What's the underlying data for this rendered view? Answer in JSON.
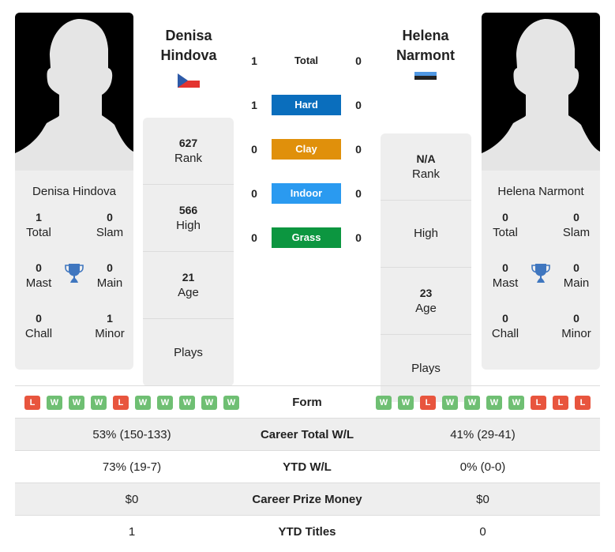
{
  "colors": {
    "hard": "#0a6ebd",
    "clay": "#e0900b",
    "indoor": "#2a9af0",
    "grass": "#0c9640",
    "win": "#6fbf73",
    "loss": "#e8553e",
    "trophy": "#3f76bf"
  },
  "player1": {
    "name_line1": "Denisa",
    "name_line2": "Hindova",
    "full_name": "Denisa Hindova",
    "flag": "czech-republic",
    "rank": "627",
    "rank_label": "Rank",
    "high": "566",
    "high_label": "High",
    "age": "21",
    "age_label": "Age",
    "plays": "",
    "plays_label": "Plays",
    "titles": {
      "total": "1",
      "total_label": "Total",
      "slam": "0",
      "slam_label": "Slam",
      "mast": "0",
      "mast_label": "Mast",
      "main": "0",
      "main_label": "Main",
      "chall": "0",
      "chall_label": "Chall",
      "minor": "1",
      "minor_label": "Minor"
    },
    "form": [
      "L",
      "W",
      "W",
      "W",
      "L",
      "W",
      "W",
      "W",
      "W",
      "W"
    ]
  },
  "player2": {
    "name_line1": "Helena",
    "name_line2": "Narmont",
    "full_name": "Helena Narmont",
    "flag": "estonia",
    "rank": "N/A",
    "rank_label": "Rank",
    "high": "",
    "high_label": "High",
    "age": "23",
    "age_label": "Age",
    "plays": "",
    "plays_label": "Plays",
    "titles": {
      "total": "0",
      "total_label": "Total",
      "slam": "0",
      "slam_label": "Slam",
      "mast": "0",
      "mast_label": "Mast",
      "main": "0",
      "main_label": "Main",
      "chall": "0",
      "chall_label": "Chall",
      "minor": "0",
      "minor_label": "Minor"
    },
    "form": [
      "W",
      "W",
      "L",
      "W",
      "W",
      "W",
      "W",
      "L",
      "L",
      "L"
    ]
  },
  "h2h": [
    {
      "label": "Total",
      "p1": "1",
      "p2": "0"
    },
    {
      "label": "Hard",
      "p1": "1",
      "p2": "0"
    },
    {
      "label": "Clay",
      "p1": "0",
      "p2": "0"
    },
    {
      "label": "Indoor",
      "p1": "0",
      "p2": "0"
    },
    {
      "label": "Grass",
      "p1": "0",
      "p2": "0"
    }
  ],
  "table": {
    "form_label": "Form",
    "rows": [
      {
        "label": "Career Total W/L",
        "p1": "53% (150-133)",
        "p2": "41% (29-41)"
      },
      {
        "label": "YTD W/L",
        "p1": "73% (19-7)",
        "p2": "0% (0-0)"
      },
      {
        "label": "Career Prize Money",
        "p1": "$0",
        "p2": "$0"
      },
      {
        "label": "YTD Titles",
        "p1": "1",
        "p2": "0"
      }
    ]
  }
}
